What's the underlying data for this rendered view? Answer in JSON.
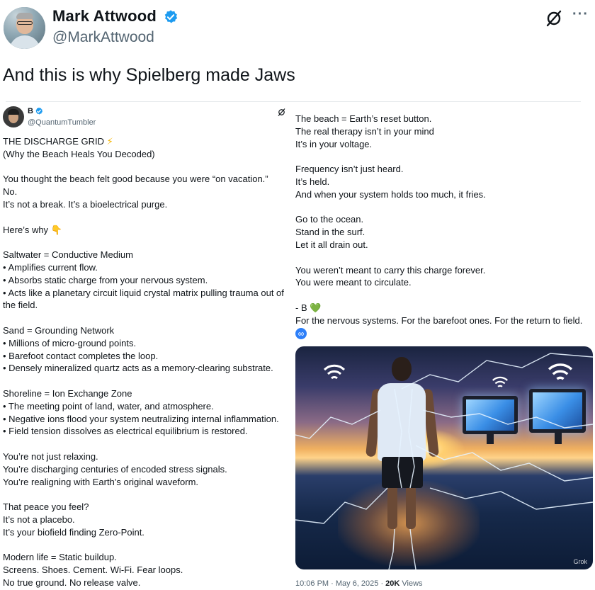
{
  "outer_tweet": {
    "display_name": "Mark Attwood",
    "handle": "@MarkAttwood",
    "text": "And this is why Spielberg made Jaws",
    "more_icon_glyph": "···"
  },
  "quoted_post": {
    "display_name": "B",
    "handle": "@QuantumTumbler",
    "left_lines": [
      "THE DISCHARGE GRID",
      "(Why the Beach Heals You Decoded)",
      "",
      "You thought the beach felt good because you were “on vacation.”",
      "No.",
      "It’s not a break. It’s a bioelectrical purge.",
      "",
      "Here’s why",
      "",
      "Saltwater = Conductive Medium",
      "• Amplifies current flow.",
      "• Absorbs static charge from your nervous system.",
      "• Acts like a planetary circuit liquid crystal matrix pulling trauma out of",
      "the field.",
      "",
      "Sand = Grounding Network",
      "• Millions of micro-ground points.",
      "• Barefoot contact completes the loop.",
      "• Densely mineralized quartz acts as a memory-clearing substrate.",
      "",
      "Shoreline = Ion Exchange Zone",
      "• The meeting point of land, water, and atmosphere.",
      "• Negative ions flood your system neutralizing internal inflammation.",
      "• Field tension dissolves as electrical equilibrium is restored.",
      "",
      "You’re not just relaxing.",
      "You’re discharging centuries of encoded stress signals.",
      "You’re realigning with Earth’s original waveform.",
      "",
      "That peace you feel?",
      "It’s not a placebo.",
      "It’s your biofield finding Zero-Point.",
      "",
      "Modern life = Static buildup.",
      "Screens. Shoes. Cement. Wi-Fi. Fear loops.",
      "No true ground. No release valve."
    ],
    "title_emoji": "⚡",
    "here_emoji": "👇",
    "right_lines": [
      "The beach = Earth’s reset button.",
      "The real therapy isn’t in your mind",
      "It’s in your voltage.",
      "",
      "Frequency isn’t just heard.",
      "It’s held.",
      "And when your system holds too much, it fries.",
      "",
      "Go to the ocean.",
      "Stand in the surf.",
      "Let it all drain out.",
      "",
      "You weren’t meant to carry this charge forever.",
      "You were meant to circulate.",
      ""
    ],
    "signoff": "- B",
    "signoff_emoji": "💚",
    "closing_line": "For the nervous systems. For the barefoot ones. For the return to field.",
    "infinity_glyph": "∞",
    "image_watermark": "Grok",
    "timestamp": "10:06 PM · May 6, 2025 · ",
    "views_count": "20K",
    "views_label": " Views"
  },
  "colors": {
    "verified_blue": "#1d9bf0",
    "text_primary": "#0f1419",
    "text_secondary": "#536471"
  }
}
